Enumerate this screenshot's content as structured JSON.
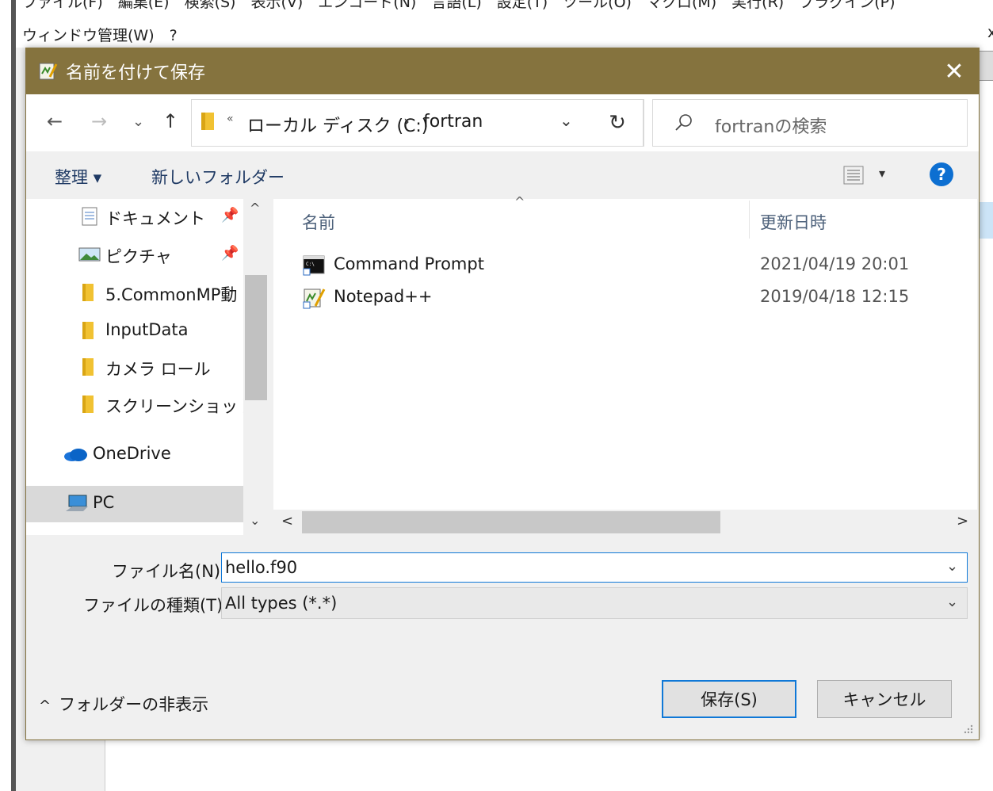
{
  "background_app": {
    "menu_line1": "ファイル(F)　編集(E)　検索(S)　表示(V)　エンコード(N)　言語(L)　設定(T)　ツール(O)　マクロ(M)　実行(R)　プラグイン(P)",
    "menu_line2": "ウィンドウ管理(W)　?",
    "close_glyph": "x"
  },
  "dialog": {
    "title": "名前を付けて保存",
    "close_glyph": "✕",
    "nav": {
      "back_glyph": "←",
      "forward_glyph": "→",
      "recent_glyph": "⌄",
      "up_glyph": "↑",
      "address_overflow": "«",
      "address_drive": "ローカル ディスク (C:)",
      "address_sep": "›",
      "address_folder": "fortran",
      "address_drop": "⌄",
      "refresh_glyph": "↻",
      "search_placeholder": "fortranの検索"
    },
    "toolbar": {
      "organize": "整理 ▾",
      "new_folder": "新しいフォルダー",
      "view_drop": "▾",
      "help": "?"
    },
    "navpane": {
      "items": [
        {
          "label": "ドキュメント",
          "icon": "documents-icon",
          "pinned": true
        },
        {
          "label": "ピクチャ",
          "icon": "pictures-icon",
          "pinned": true
        },
        {
          "label": "5.CommonMP動",
          "icon": "folder-icon",
          "pinned": false
        },
        {
          "label": "InputData",
          "icon": "folder-icon",
          "pinned": false
        },
        {
          "label": "カメラ ロール",
          "icon": "folder-icon",
          "pinned": false
        },
        {
          "label": "スクリーンショット",
          "icon": "folder-icon",
          "pinned": false
        },
        {
          "label": "OneDrive",
          "icon": "onedrive-icon",
          "pinned": false
        },
        {
          "label": "PC",
          "icon": "pc-icon",
          "pinned": false
        }
      ],
      "pin_glyph": "📌",
      "scroll_up": "^",
      "scroll_down": "⌄"
    },
    "filelist": {
      "sort_glyph": "^",
      "col_name": "名前",
      "col_date": "更新日時",
      "files": [
        {
          "name": "Command Prompt",
          "date": "2021/04/19 20:01",
          "icon": "command-prompt-icon"
        },
        {
          "name": "Notepad++",
          "date": "2019/04/18 12:15",
          "icon": "notepadpp-icon"
        }
      ],
      "hscroll_left": "<",
      "hscroll_right": ">"
    },
    "form": {
      "filename_label": "ファイル名(N):",
      "filename_value": "hello.f90",
      "filetype_label": "ファイルの種類(T):",
      "filetype_value": "All types (*.*)",
      "drop_glyph": "⌄"
    },
    "footer": {
      "hide_folders": "フォルダーの非表示",
      "hide_caret": "^",
      "save": "保存(S)",
      "cancel": "キャンセル"
    }
  }
}
